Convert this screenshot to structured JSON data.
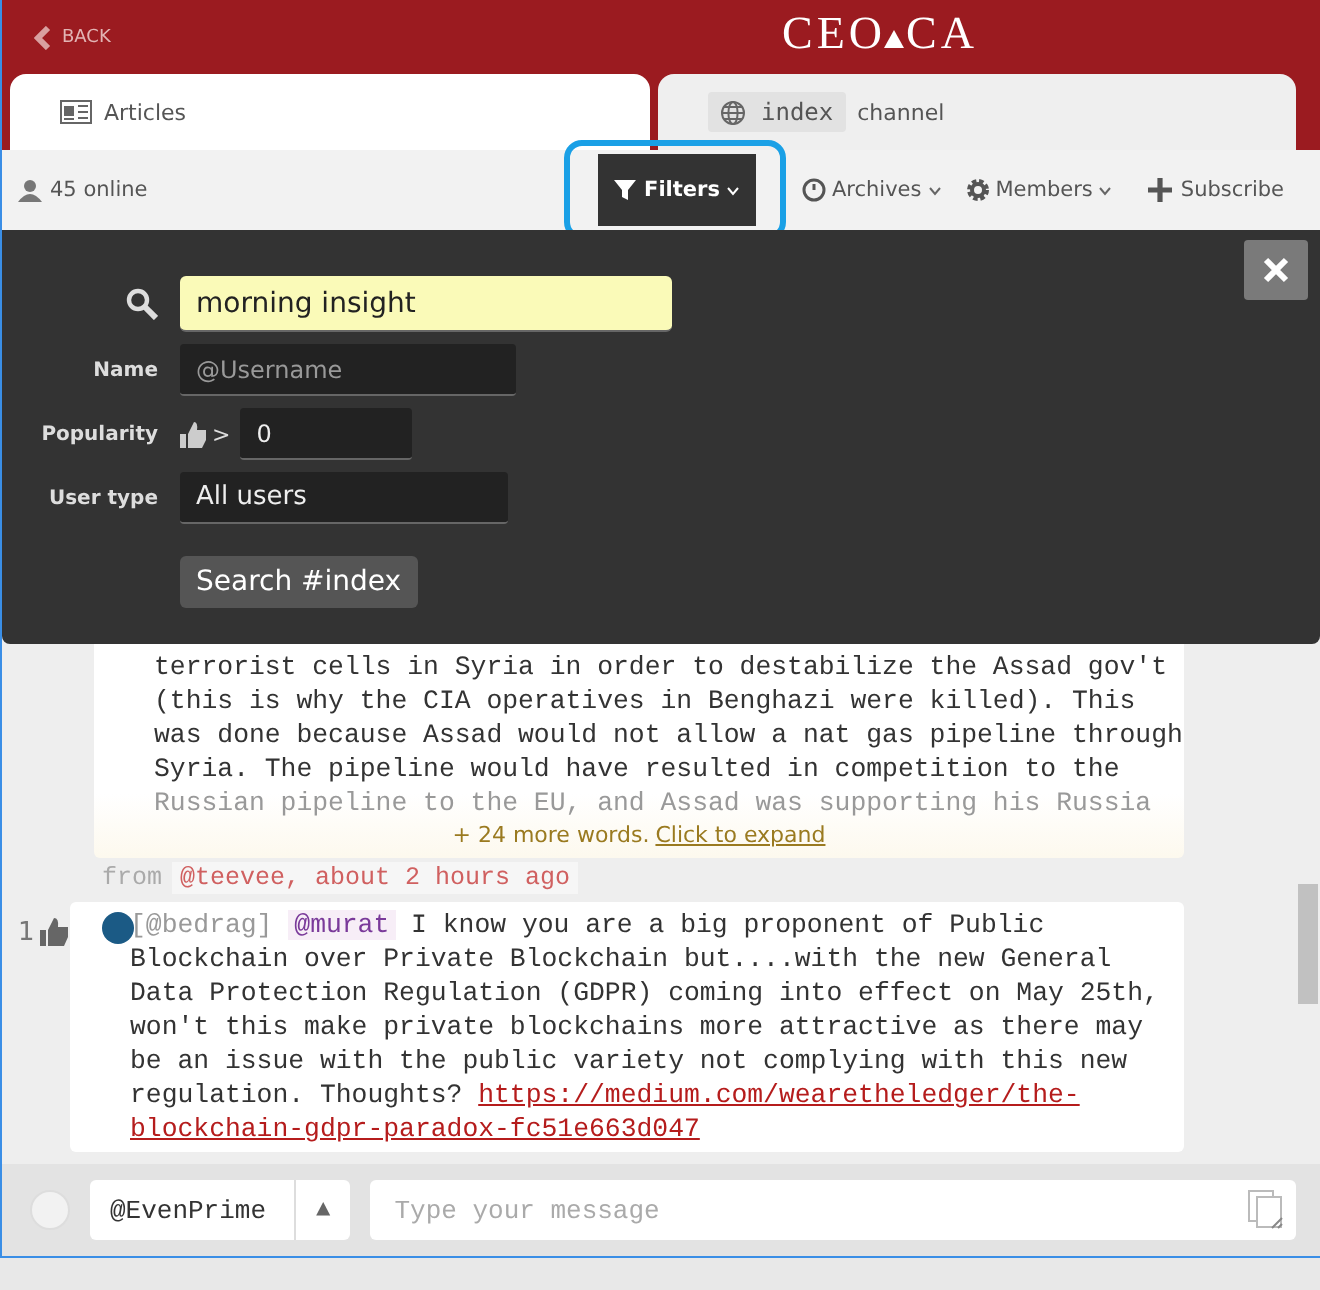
{
  "header": {
    "back": "BACK",
    "logo_left": "CEO",
    "logo_right": "CA"
  },
  "tabs": [
    {
      "label": "Articles",
      "selected": true,
      "kind": "articles"
    },
    {
      "label": "index",
      "suffix": "channel",
      "selected": false,
      "kind": "channel"
    }
  ],
  "toolbar": {
    "online": "45 online",
    "menus": [
      {
        "label": "Filters",
        "selected": true,
        "highlighted": true,
        "kind": "filter"
      },
      {
        "label": "Archives",
        "selected": false,
        "highlighted": false,
        "kind": "clock"
      },
      {
        "label": "Members",
        "selected": false,
        "highlighted": false,
        "kind": "gear"
      }
    ],
    "subscribe": "Subscribe"
  },
  "filters": {
    "query": "morning insight",
    "name_label": "Name",
    "name_placeholder": "@Username",
    "popularity_label": "Popularity",
    "popularity_op": ">",
    "popularity_value": "0",
    "user_type_label": "User type",
    "user_type": "All users",
    "search_button": "Search #index"
  },
  "messages": [
    {
      "lines": [
        "terrorist cells in Syria in order to destabilize the Assad gov't",
        "(this is why the CIA operatives in Benghazi were killed). This",
        "was done because Assad would not allow a nat gas pipeline through",
        "Syria. The pipeline would have resulted in competition to the"
      ],
      "faded_line": "Russian pipeline to the EU, and Assad was supporting his Russia",
      "more": "+ 24 more words.",
      "expand": "Click to expand",
      "from": "from",
      "author": "@teevee, about 2 hours ago"
    },
    {
      "likes": "1",
      "reply_to": "[@bedrag]",
      "mention": "@murat",
      "text": "I know you are a big proponent of Public Blockchain over Private Blockchain but....with the new General Data Protection Regulation (GDPR) coming into effect on May 25th, won't this make private blockchains more attractive as there may be an issue with the public variety not complying with this new regulation. Thoughts?",
      "link_parts": [
        "https://medium.com/wearetheledger/the-",
        "blockchain-gdpr-paradox-fc51e663d047"
      ]
    }
  ],
  "composer": {
    "identity": "@EvenPrime",
    "toggle": "▲",
    "placeholder": "Type your message"
  }
}
